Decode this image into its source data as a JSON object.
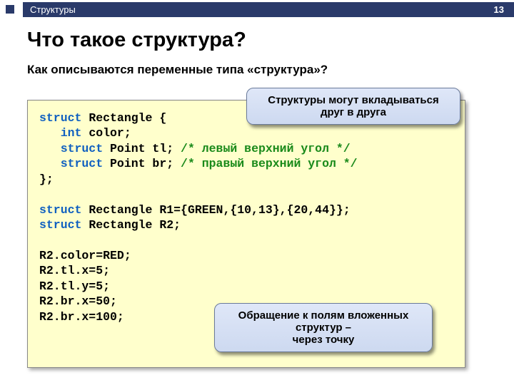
{
  "header": {
    "breadcrumb": "Структуры",
    "page_number": "13"
  },
  "title": "Что такое структура?",
  "subtitle": "Как описываются переменные типа «структура»?",
  "code": {
    "l1a": "struct",
    "l1b": " Rectangle {",
    "l2a": "   int",
    "l2b": " color;",
    "l3a": "   struct",
    "l3b": " Point tl; ",
    "l3c": "/* левый верхний угол */",
    "l4a": "   struct",
    "l4b": " Point br; ",
    "l4c": "/* правый верхний угол */",
    "l5": "};",
    "l7a": "struct",
    "l7b": " Rectangle R1={GREEN,{10,13},{20,44}};",
    "l8a": "struct",
    "l8b": " Rectangle R2;",
    "l10": "R2.color=RED;",
    "l11": "R2.tl.x=5;",
    "l12": "R2.tl.y=5;",
    "l13": "R2.br.x=50;",
    "l14": "R2.br.x=100;"
  },
  "callouts": {
    "c1_line1": "Структуры могут вкладываться",
    "c1_line2": "друг в друга",
    "c2_line1": "Обращение к полям вложенных",
    "c2_line2": "структур –",
    "c2_line3": "через точку"
  }
}
